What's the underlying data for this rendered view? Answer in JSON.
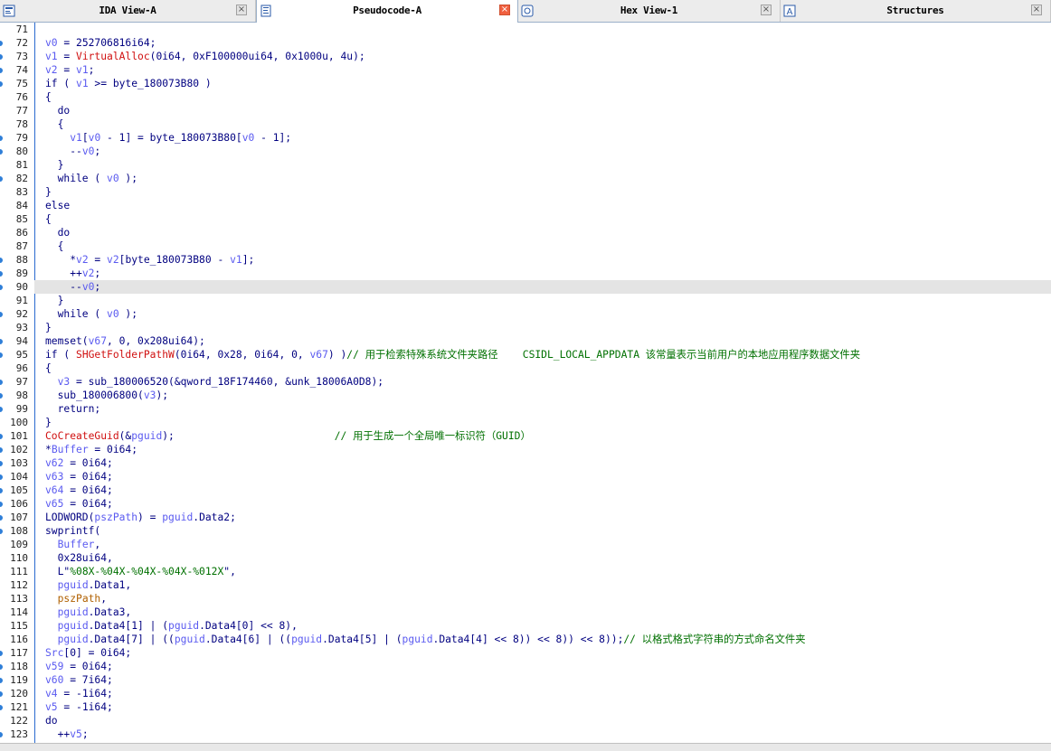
{
  "tabs": [
    {
      "label": "IDA View-A",
      "icon": "ida-view-icon",
      "active": false
    },
    {
      "label": "Pseudocode-A",
      "icon": "pseudocode-icon",
      "active": true
    },
    {
      "label": "Hex View-1",
      "icon": "hex-view-icon",
      "active": false
    },
    {
      "label": "Structures",
      "icon": "structures-icon",
      "active": false
    }
  ],
  "close_glyph": "×",
  "highlighted_line": 90,
  "colors": {
    "keyword": "#000080",
    "variable": "#5a5af0",
    "function": "#d01010",
    "global": "#b06000",
    "comment": "#007000",
    "highlight": "#e4e4e4"
  },
  "lines": [
    {
      "n": 71,
      "dot": false,
      "t": []
    },
    {
      "n": 72,
      "dot": true,
      "t": [
        [
          "v",
          "v0"
        ],
        [
          "k",
          " = 252706816i64;"
        ]
      ]
    },
    {
      "n": 73,
      "dot": true,
      "t": [
        [
          "v",
          "v1"
        ],
        [
          "k",
          " = "
        ],
        [
          "f",
          "VirtualAlloc"
        ],
        [
          "k",
          "(0i64, 0xF100000ui64, 0x1000u, 4u);"
        ]
      ]
    },
    {
      "n": 74,
      "dot": true,
      "t": [
        [
          "v",
          "v2"
        ],
        [
          "k",
          " = "
        ],
        [
          "v",
          "v1"
        ],
        [
          "k",
          ";"
        ]
      ]
    },
    {
      "n": 75,
      "dot": true,
      "t": [
        [
          "k",
          "if ( "
        ],
        [
          "v",
          "v1"
        ],
        [
          "k",
          " >= byte_180073B80 )"
        ]
      ]
    },
    {
      "n": 76,
      "dot": false,
      "t": [
        [
          "k",
          "{"
        ]
      ]
    },
    {
      "n": 77,
      "dot": false,
      "t": [
        [
          "k",
          "  do"
        ]
      ]
    },
    {
      "n": 78,
      "dot": false,
      "t": [
        [
          "k",
          "  {"
        ]
      ]
    },
    {
      "n": 79,
      "dot": true,
      "t": [
        [
          "k",
          "    "
        ],
        [
          "v",
          "v1"
        ],
        [
          "k",
          "["
        ],
        [
          "v",
          "v0"
        ],
        [
          "k",
          " - 1] = byte_180073B80["
        ],
        [
          "v",
          "v0"
        ],
        [
          "k",
          " - 1];"
        ]
      ]
    },
    {
      "n": 80,
      "dot": true,
      "t": [
        [
          "k",
          "    --"
        ],
        [
          "v",
          "v0"
        ],
        [
          "k",
          ";"
        ]
      ]
    },
    {
      "n": 81,
      "dot": false,
      "t": [
        [
          "k",
          "  }"
        ]
      ]
    },
    {
      "n": 82,
      "dot": true,
      "t": [
        [
          "k",
          "  while ( "
        ],
        [
          "v",
          "v0"
        ],
        [
          "k",
          " );"
        ]
      ]
    },
    {
      "n": 83,
      "dot": false,
      "t": [
        [
          "k",
          "}"
        ]
      ]
    },
    {
      "n": 84,
      "dot": false,
      "t": [
        [
          "k",
          "else"
        ]
      ]
    },
    {
      "n": 85,
      "dot": false,
      "t": [
        [
          "k",
          "{"
        ]
      ]
    },
    {
      "n": 86,
      "dot": false,
      "t": [
        [
          "k",
          "  do"
        ]
      ]
    },
    {
      "n": 87,
      "dot": false,
      "t": [
        [
          "k",
          "  {"
        ]
      ]
    },
    {
      "n": 88,
      "dot": true,
      "t": [
        [
          "k",
          "    *"
        ],
        [
          "v",
          "v2"
        ],
        [
          "k",
          " = "
        ],
        [
          "v",
          "v2"
        ],
        [
          "k",
          "[byte_180073B80 - "
        ],
        [
          "v",
          "v1"
        ],
        [
          "k",
          "];"
        ]
      ]
    },
    {
      "n": 89,
      "dot": true,
      "t": [
        [
          "k",
          "    ++"
        ],
        [
          "v",
          "v2"
        ],
        [
          "k",
          ";"
        ]
      ]
    },
    {
      "n": 90,
      "dot": true,
      "t": [
        [
          "k",
          "    --"
        ],
        [
          "v",
          "v0"
        ],
        [
          "k",
          ";"
        ]
      ]
    },
    {
      "n": 91,
      "dot": false,
      "t": [
        [
          "k",
          "  }"
        ]
      ]
    },
    {
      "n": 92,
      "dot": true,
      "t": [
        [
          "k",
          "  while ( "
        ],
        [
          "v",
          "v0"
        ],
        [
          "k",
          " );"
        ]
      ]
    },
    {
      "n": 93,
      "dot": false,
      "t": [
        [
          "k",
          "}"
        ]
      ]
    },
    {
      "n": 94,
      "dot": true,
      "t": [
        [
          "k",
          "memset("
        ],
        [
          "v",
          "v67"
        ],
        [
          "k",
          ", 0, 0x208ui64);"
        ]
      ]
    },
    {
      "n": 95,
      "dot": true,
      "t": [
        [
          "k",
          "if ( "
        ],
        [
          "f",
          "SHGetFolderPathW"
        ],
        [
          "k",
          "(0i64, 0x28, 0i64, 0, "
        ],
        [
          "v",
          "v67"
        ],
        [
          "k",
          ") )"
        ],
        [
          "c",
          "// 用于检索特殊系统文件夹路径    CSIDL_LOCAL_APPDATA 该常量表示当前用户的本地应用程序数据文件夹"
        ]
      ]
    },
    {
      "n": 96,
      "dot": false,
      "t": [
        [
          "k",
          "{"
        ]
      ]
    },
    {
      "n": 97,
      "dot": true,
      "t": [
        [
          "k",
          "  "
        ],
        [
          "v",
          "v3"
        ],
        [
          "k",
          " = sub_180006520(&qword_18F174460, &unk_18006A0D8);"
        ]
      ]
    },
    {
      "n": 98,
      "dot": true,
      "t": [
        [
          "k",
          "  sub_180006800("
        ],
        [
          "v",
          "v3"
        ],
        [
          "k",
          ");"
        ]
      ]
    },
    {
      "n": 99,
      "dot": true,
      "t": [
        [
          "k",
          "  return;"
        ]
      ]
    },
    {
      "n": 100,
      "dot": false,
      "t": [
        [
          "k",
          "}"
        ]
      ]
    },
    {
      "n": 101,
      "dot": true,
      "t": [
        [
          "f",
          "CoCreateGuid"
        ],
        [
          "k",
          "(&"
        ],
        [
          "v",
          "pguid"
        ],
        [
          "k",
          ");                          "
        ],
        [
          "c",
          "// 用于生成一个全局唯一标识符（GUID）"
        ]
      ]
    },
    {
      "n": 102,
      "dot": true,
      "t": [
        [
          "k",
          "*"
        ],
        [
          "v",
          "Buffer"
        ],
        [
          "k",
          " = 0i64;"
        ]
      ]
    },
    {
      "n": 103,
      "dot": true,
      "t": [
        [
          "v",
          "v62"
        ],
        [
          "k",
          " = 0i64;"
        ]
      ]
    },
    {
      "n": 104,
      "dot": true,
      "t": [
        [
          "v",
          "v63"
        ],
        [
          "k",
          " = 0i64;"
        ]
      ]
    },
    {
      "n": 105,
      "dot": true,
      "t": [
        [
          "v",
          "v64"
        ],
        [
          "k",
          " = 0i64;"
        ]
      ]
    },
    {
      "n": 106,
      "dot": true,
      "t": [
        [
          "v",
          "v65"
        ],
        [
          "k",
          " = 0i64;"
        ]
      ]
    },
    {
      "n": 107,
      "dot": true,
      "t": [
        [
          "k",
          "LODWORD("
        ],
        [
          "v",
          "pszPath"
        ],
        [
          "k",
          ") = "
        ],
        [
          "v",
          "pguid"
        ],
        [
          "k",
          ".Data2;"
        ]
      ]
    },
    {
      "n": 108,
      "dot": true,
      "t": [
        [
          "k",
          "swprintf("
        ]
      ]
    },
    {
      "n": 109,
      "dot": false,
      "t": [
        [
          "k",
          "  "
        ],
        [
          "v",
          "Buffer"
        ],
        [
          "k",
          ","
        ]
      ]
    },
    {
      "n": 110,
      "dot": false,
      "t": [
        [
          "k",
          "  0x28ui64,"
        ]
      ]
    },
    {
      "n": 111,
      "dot": false,
      "t": [
        [
          "k",
          "  L\""
        ],
        [
          "c",
          "%08X-%04X-%04X-%04X-%012X"
        ],
        [
          "k",
          "\","
        ]
      ]
    },
    {
      "n": 112,
      "dot": false,
      "t": [
        [
          "k",
          "  "
        ],
        [
          "v",
          "pguid"
        ],
        [
          "k",
          ".Data1,"
        ]
      ]
    },
    {
      "n": 113,
      "dot": false,
      "t": [
        [
          "k",
          "  "
        ],
        [
          "g",
          "pszPath"
        ],
        [
          "k",
          ","
        ]
      ]
    },
    {
      "n": 114,
      "dot": false,
      "t": [
        [
          "k",
          "  "
        ],
        [
          "v",
          "pguid"
        ],
        [
          "k",
          ".Data3,"
        ]
      ]
    },
    {
      "n": 115,
      "dot": false,
      "t": [
        [
          "k",
          "  "
        ],
        [
          "v",
          "pguid"
        ],
        [
          "k",
          ".Data4[1] | ("
        ],
        [
          "v",
          "pguid"
        ],
        [
          "k",
          ".Data4[0] << 8),"
        ]
      ]
    },
    {
      "n": 116,
      "dot": false,
      "t": [
        [
          "k",
          "  "
        ],
        [
          "v",
          "pguid"
        ],
        [
          "k",
          ".Data4[7] | (("
        ],
        [
          "v",
          "pguid"
        ],
        [
          "k",
          ".Data4[6] | (("
        ],
        [
          "v",
          "pguid"
        ],
        [
          "k",
          ".Data4[5] | ("
        ],
        [
          "v",
          "pguid"
        ],
        [
          "k",
          ".Data4[4] << 8)) << 8)) << 8));"
        ],
        [
          "c",
          "// 以格式格式字符串的方式命名文件夹"
        ]
      ]
    },
    {
      "n": 117,
      "dot": true,
      "t": [
        [
          "v",
          "Src"
        ],
        [
          "k",
          "[0] = 0i64;"
        ]
      ]
    },
    {
      "n": 118,
      "dot": true,
      "t": [
        [
          "v",
          "v59"
        ],
        [
          "k",
          " = 0i64;"
        ]
      ]
    },
    {
      "n": 119,
      "dot": true,
      "t": [
        [
          "v",
          "v60"
        ],
        [
          "k",
          " = 7i64;"
        ]
      ]
    },
    {
      "n": 120,
      "dot": true,
      "t": [
        [
          "v",
          "v4"
        ],
        [
          "k",
          " = -1i64;"
        ]
      ]
    },
    {
      "n": 121,
      "dot": true,
      "t": [
        [
          "v",
          "v5"
        ],
        [
          "k",
          " = -1i64;"
        ]
      ]
    },
    {
      "n": 122,
      "dot": false,
      "t": [
        [
          "k",
          "do"
        ]
      ]
    },
    {
      "n": 123,
      "dot": true,
      "t": [
        [
          "k",
          "  ++"
        ],
        [
          "v",
          "v5"
        ],
        [
          "k",
          ";"
        ]
      ]
    }
  ]
}
